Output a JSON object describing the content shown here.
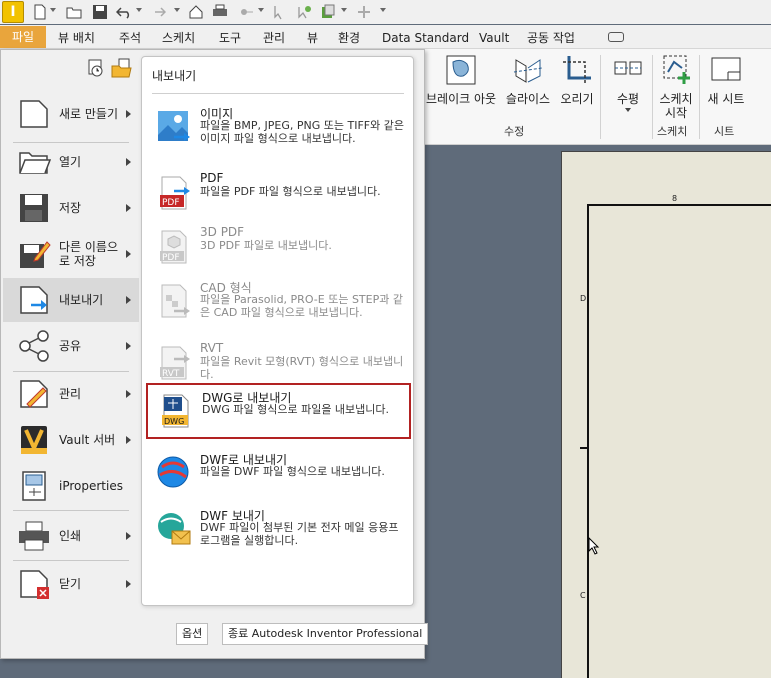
{
  "ribbon_tabs": [
    "뷰 배치",
    "주석",
    "스케치",
    "도구",
    "관리",
    "뷰",
    "환경",
    "Data Standard",
    "Vault",
    "공동 작업"
  ],
  "file_tab": "파일",
  "ribbon": {
    "buttons": [
      "브레이크 아웃",
      "슬라이스",
      "오리기",
      "수평",
      "스케치 시작",
      "새 시트"
    ],
    "groups": [
      "수정",
      "스케치",
      "시트"
    ]
  },
  "file_menu": {
    "items": [
      {
        "label": "새로 만들기",
        "icon": "new-file-icon",
        "arrow": true
      },
      {
        "label": "열기",
        "icon": "open-folder-icon",
        "arrow": true
      },
      {
        "label": "저장",
        "icon": "save-icon",
        "arrow": true
      },
      {
        "label": "다른 이름으로 저장",
        "icon": "save-as-icon",
        "arrow": true
      },
      {
        "label": "내보내기",
        "icon": "export-icon",
        "arrow": true,
        "active": true
      },
      {
        "label": "공유",
        "icon": "share-icon",
        "arrow": true
      },
      {
        "label": "관리",
        "icon": "manage-icon",
        "arrow": true
      },
      {
        "label": "Vault 서버",
        "icon": "vault-icon",
        "arrow": true
      },
      {
        "label": "iProperties",
        "icon": "iproperties-icon",
        "arrow": false
      },
      {
        "label": "인쇄",
        "icon": "print-icon",
        "arrow": true
      },
      {
        "label": "닫기",
        "icon": "close-file-icon",
        "arrow": true
      }
    ],
    "export_submenu": {
      "title": "내보내기",
      "items": [
        {
          "title": "이미지",
          "desc": "파일을 BMP, JPEG, PNG 또는 TIFF와 같은 이미지 파일 형식으로 내보냅니다.",
          "disabled": false
        },
        {
          "title": "PDF",
          "desc": "파일을 PDF 파일 형식으로 내보냅니다.",
          "disabled": false
        },
        {
          "title": "3D PDF",
          "desc": "3D PDF 파일로 내보냅니다.",
          "disabled": true
        },
        {
          "title": "CAD 형식",
          "desc": "파일을 Parasolid, PRO-E 또는 STEP과 같은 CAD 파일 형식으로 내보냅니다.",
          "disabled": true
        },
        {
          "title": "RVT",
          "desc": "파일을 Revit 모형(RVT) 형식으로 내보냅니다.",
          "disabled": true
        },
        {
          "title": "DWG로 내보내기",
          "desc": "DWG 파일 형식으로 파일을 내보냅니다.",
          "disabled": false,
          "selected": true
        },
        {
          "title": "DWF로 내보내기",
          "desc": "파일을 DWF 파일 형식으로 내보냅니다.",
          "disabled": false
        },
        {
          "title": "DWF 보내기",
          "desc": "DWF 파일이 첨부된 기본 전자 메일 응용프로그램을 실행합니다.",
          "disabled": false
        }
      ]
    },
    "footer": {
      "options": "옵션",
      "exit": "종료 Autodesk Inventor Professional"
    }
  },
  "drawing": {
    "zone_top": "8",
    "zone_d": "D",
    "zone_c": "C"
  },
  "colors": {
    "file_tab": "#e9a53c",
    "selected_border": "#b22222",
    "sheet": "#e8e6d8",
    "canvas": "#5f6b7a"
  }
}
